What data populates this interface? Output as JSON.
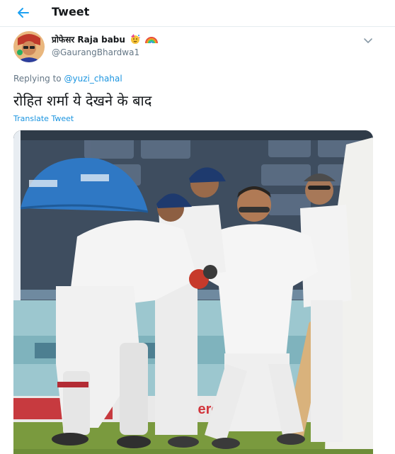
{
  "header": {
    "title": "Tweet",
    "back_icon": "arrow-left-icon"
  },
  "tweet": {
    "author_name": "प्रोफेसर Raja babu",
    "author_emojis": [
      "party-face-emoji",
      "rainbow-emoji"
    ],
    "handle": "@GaurangBhardwa1",
    "menu_icon": "chevron-down-icon",
    "replying_label": "Replying to",
    "replying_to": "@yuzi_chahal",
    "text": "रोहित शर्मा ये देखने के बाद",
    "translate_label": "Translate Tweet"
  },
  "media": {
    "description_icon": "photo-cricket-team-celebration",
    "ad_board_text": "Hero"
  },
  "colors": {
    "accent": "#1b95e0",
    "secondary_text": "#657786",
    "divider": "#e6ecf0"
  }
}
